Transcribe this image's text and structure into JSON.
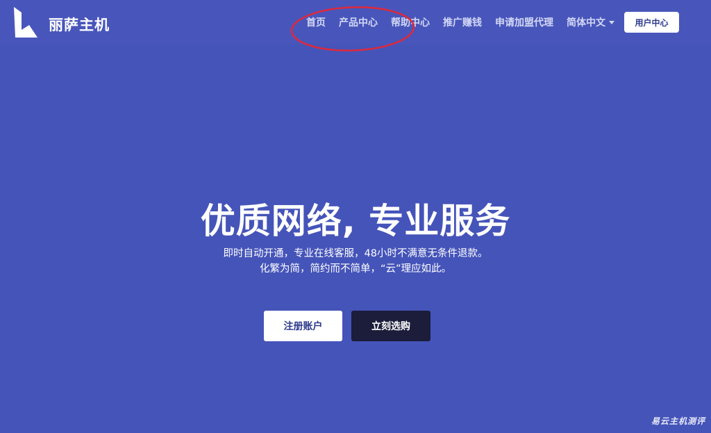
{
  "brand": {
    "name": "丽萨主机",
    "logo_icon": "brand-l-logo-icon"
  },
  "nav": {
    "items": [
      "首页",
      "产品中心",
      "帮助中心",
      "推广赚钱",
      "申请加盟代理"
    ],
    "language": "简体中文",
    "language_icon": "chevron-down-icon",
    "user_center": "用户中心"
  },
  "hero": {
    "title": "优质网络, 专业服务",
    "line1": "即时自动开通，专业在线客服，48小时不满意无条件退款。",
    "line2": "化繁为简，简约而不简单，“云”理应如此。",
    "register_label": "注册账户",
    "buy_label": "立刻选购"
  },
  "watermark": "易云主机测评",
  "colors": {
    "background": "#4554b9",
    "header": "#4856bb",
    "dark_button": "#1b1d3a",
    "annotation": "#e0283a"
  }
}
